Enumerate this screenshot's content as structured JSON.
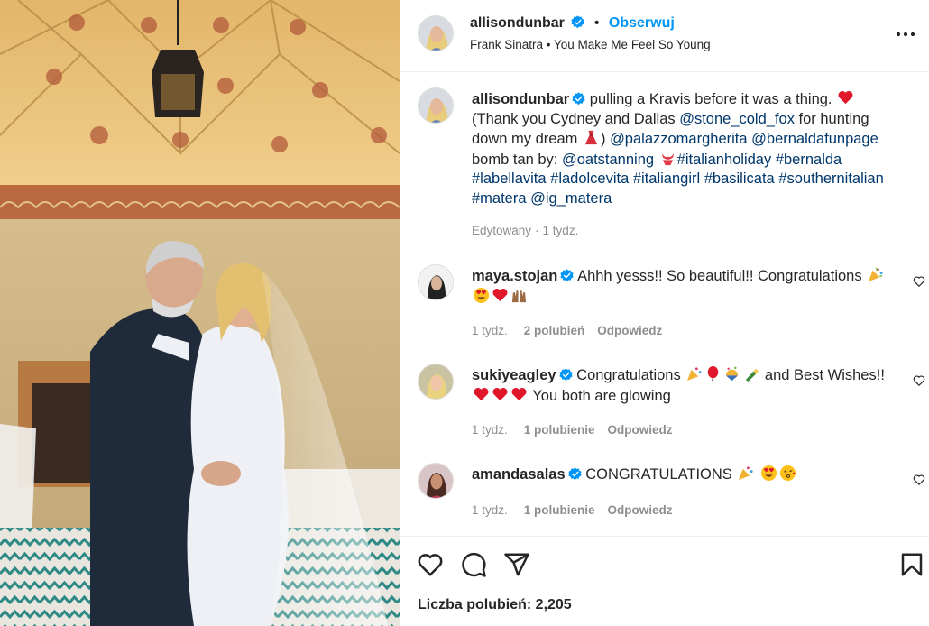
{
  "post": {
    "author": "allisondunbar",
    "follow_label": "Obserwuj",
    "separator": "•",
    "audio": "Frank Sinatra • You Make Me Feel So Young",
    "more_icon": "more-horizontal-icon"
  },
  "caption": {
    "author": "allisondunbar",
    "t1": " pulling a Kravis before it was a thing. ",
    "t2": " (Thank you Cydney and Dallas ",
    "m1": "@stone_cold_fox",
    "t3": " for hunting down my dream ",
    "t4": ") ",
    "m2": "@palazzomargherita",
    "t5": " ",
    "m3": "@bernaldafunpage",
    "t6": " bomb tan by: ",
    "m4": "@oatstanning",
    "t7": " ",
    "tags": "#italianholiday #bernalda #labellavita #ladolcevita #italiangirl #basilicata #southernitalian #matera",
    "t8": " ",
    "m5": "@ig_matera",
    "edited": "Edytowany",
    "time": "1 tydz."
  },
  "comments": [
    {
      "user": "maya.stojan",
      "text": "Ahhh yesss!! So beautiful!! Congratulations",
      "time": "1 tydz.",
      "likes": "2 polubień",
      "reply": "Odpowiedz"
    },
    {
      "user": "sukiyeagley",
      "text_a": "Congratulations",
      "text_b": "and Best Wishes!!",
      "text_c": "You both are glowing",
      "time": "1 tydz.",
      "likes": "1 polubienie",
      "reply": "Odpowiedz"
    },
    {
      "user": "amandasalas",
      "text": "CONGRATULATIONS",
      "time": "1 tydz.",
      "likes": "1 polubienie",
      "reply": "Odpowiedz"
    }
  ],
  "actions": {
    "icons": [
      "heart-icon",
      "comment-icon",
      "share-icon",
      "bookmark-icon"
    ]
  },
  "likes_label": "Liczba polubień: 2,205",
  "colors": {
    "link": "#00376b",
    "follow": "#0095f6",
    "verified": "#0095f6",
    "meta": "#8e8e8e"
  }
}
